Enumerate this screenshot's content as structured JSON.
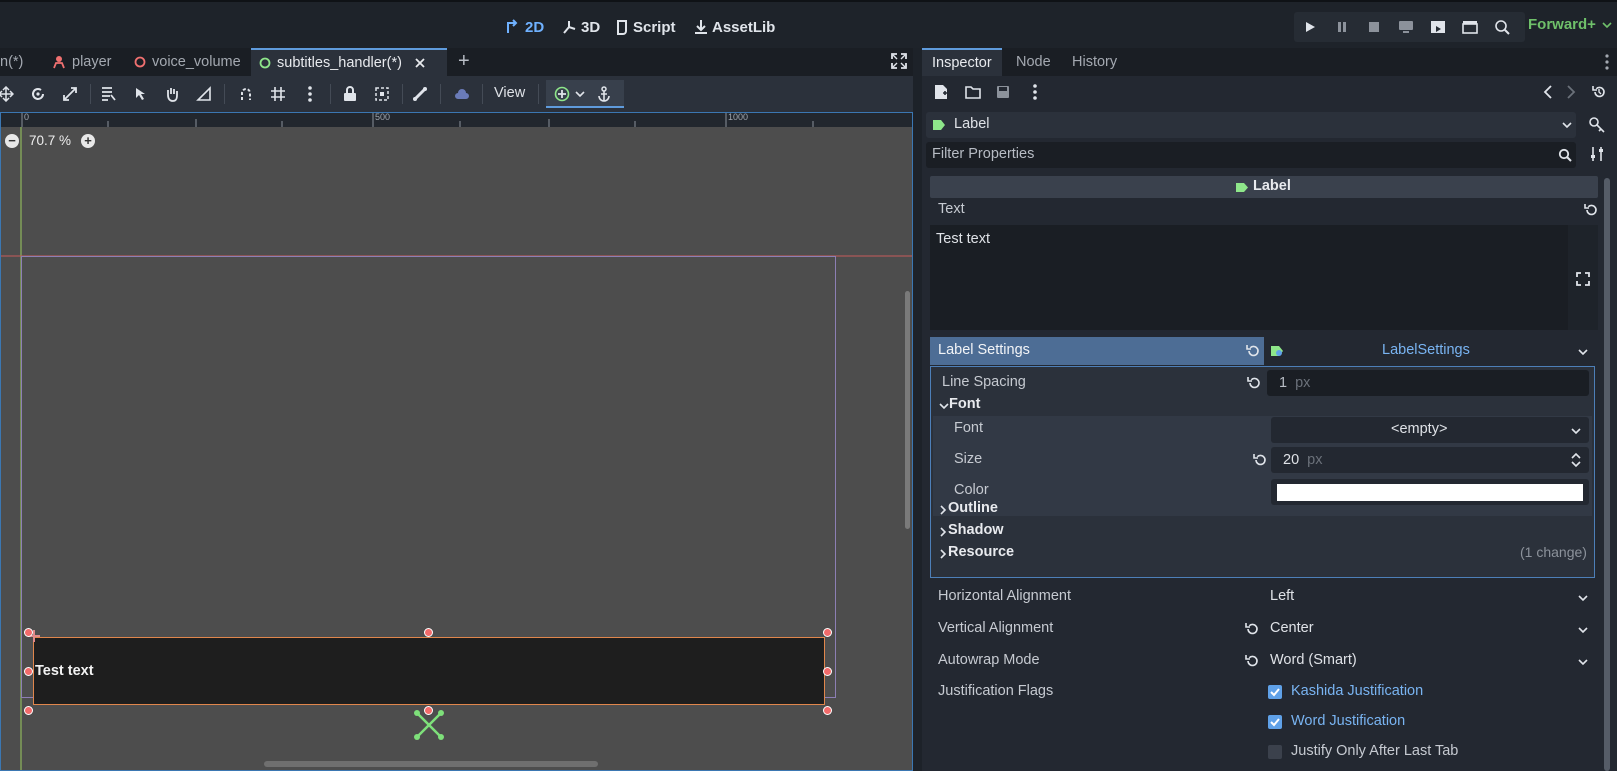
{
  "topbar": {
    "modes": [
      {
        "label": "2D",
        "active": true
      },
      {
        "label": "3D",
        "active": false
      },
      {
        "label": "Script",
        "active": false
      },
      {
        "label": "AssetLib",
        "active": false
      }
    ],
    "renderer": "Forward+"
  },
  "scene_tabs": [
    {
      "label": "n(*)",
      "icon": "scene-icon"
    },
    {
      "label": "player",
      "icon": "person-icon"
    },
    {
      "label": "voice_volume",
      "icon": "node-icon"
    },
    {
      "label": "subtitles_handler(*)",
      "icon": "node-icon",
      "active": true
    }
  ],
  "toolbar": {
    "view_label": "View"
  },
  "viewport": {
    "zoom": "70.7 %",
    "ruler_ticks": [
      "0",
      "500",
      "1000"
    ],
    "label_text": "Test text"
  },
  "inspector": {
    "tabs": [
      "Inspector",
      "Node",
      "History"
    ],
    "object_type": "Label",
    "filter_placeholder": "Filter Properties",
    "section_title": "Label",
    "text_label": "Text",
    "text_value": "Test text",
    "label_settings": {
      "label": "Label Settings",
      "resource": "LabelSettings",
      "line_spacing_label": "Line Spacing",
      "line_spacing_value": "1",
      "line_spacing_unit": "px",
      "font_group": "Font",
      "font_label": "Font",
      "font_value": "<empty>",
      "size_label": "Size",
      "size_value": "20",
      "size_unit": "px",
      "color_label": "Color",
      "color_value": "#ffffff",
      "outline": "Outline",
      "shadow": "Shadow",
      "resource_group": "Resource",
      "resource_changes": "(1 change)"
    },
    "props": {
      "h_align_label": "Horizontal Alignment",
      "h_align_value": "Left",
      "v_align_label": "Vertical Alignment",
      "v_align_value": "Center",
      "autowrap_label": "Autowrap Mode",
      "autowrap_value": "Word (Smart)",
      "justification_label": "Justification Flags",
      "flags": [
        {
          "label": "Kashida Justification",
          "checked": true
        },
        {
          "label": "Word Justification",
          "checked": true
        },
        {
          "label": "Justify Only After Last Tab",
          "checked": false
        }
      ]
    }
  },
  "colors": {
    "accent": "#5f9bdc",
    "selection_outline": "#e0864c",
    "handle": "#f26b6b",
    "label_green": "#6fc06a"
  }
}
